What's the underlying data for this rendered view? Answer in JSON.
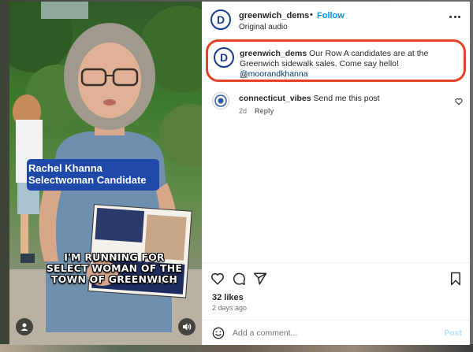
{
  "post": {
    "username": "greenwich_dems",
    "follow_label": "Follow",
    "audio": "Original audio",
    "dot": "•",
    "more_icon": "more-horizontal-icon"
  },
  "media": {
    "badge_line1": "Rachel Khanna",
    "badge_line2": "Selectwoman Candidate",
    "caption_line1": "I'M RUNNING FOR",
    "caption_line2": "SELECT WOMAN OF THE",
    "caption_line3": "TOWN OF GREENWICH",
    "flyer_text": "HANNA",
    "badge_color": "#1f49a8"
  },
  "caption": {
    "username": "greenwich_dems",
    "text": " Our Row A candidates are at the Greenwich sidewalk sales. Come say hello! ",
    "mention": "@moorandkhanna",
    "time": "2d",
    "highlight_color": "#e5402a"
  },
  "comments": [
    {
      "username": "connecticut_vibes",
      "text": " Send me this post",
      "time": "2d",
      "reply_label": "Reply"
    }
  ],
  "actions": {
    "likes": "32 likes",
    "posted_ago": "2 days ago"
  },
  "comment_box": {
    "placeholder": "Add a comment...",
    "post_label": "Post"
  },
  "colors": {
    "link": "#0095f6",
    "mention": "#00376b",
    "text": "#262626",
    "muted": "#737373"
  }
}
